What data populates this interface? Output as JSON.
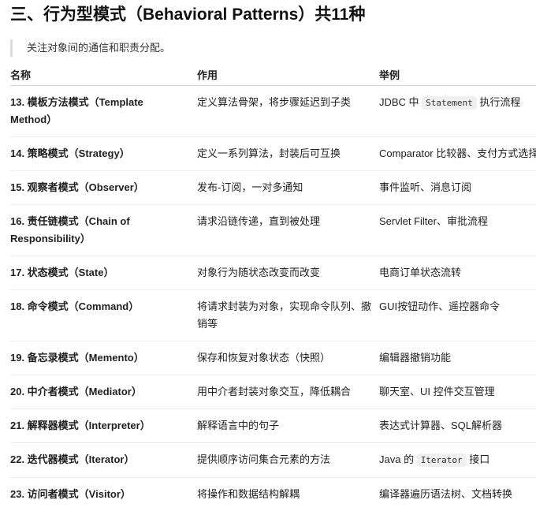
{
  "heading": "三、行为型模式（Behavioral Patterns）共11种",
  "note": "关注对象间的通信和职责分配。",
  "table": {
    "headers": [
      "名称",
      "作用",
      "举例"
    ],
    "rows": [
      {
        "name": "13. 模板方法模式（Template Method）",
        "purpose": "定义算法骨架，将步骤延迟到子类",
        "ex_before": "JDBC 中 ",
        "ex_code": "Statement",
        "ex_after": " 执行流程"
      },
      {
        "name": "14. 策略模式（Strategy）",
        "purpose": "定义一系列算法，封装后可互换",
        "ex_before": "Comparator 比较器、支付方式选择",
        "ex_code": "",
        "ex_after": ""
      },
      {
        "name": "15. 观察者模式（Observer）",
        "purpose": "发布-订阅，一对多通知",
        "ex_before": "事件监听、消息订阅",
        "ex_code": "",
        "ex_after": ""
      },
      {
        "name": "16. 责任链模式（Chain of Responsibility）",
        "purpose": "请求沿链传递，直到被处理",
        "ex_before": "Servlet Filter、审批流程",
        "ex_code": "",
        "ex_after": ""
      },
      {
        "name": "17. 状态模式（State）",
        "purpose": "对象行为随状态改变而改变",
        "ex_before": "电商订单状态流转",
        "ex_code": "",
        "ex_after": ""
      },
      {
        "name": "18. 命令模式（Command）",
        "purpose": "将请求封装为对象，实现命令队列、撤销等",
        "ex_before": "GUI按钮动作、遥控器命令",
        "ex_code": "",
        "ex_after": ""
      },
      {
        "name": "19. 备忘录模式（Memento）",
        "purpose": "保存和恢复对象状态（快照）",
        "ex_before": "编辑器撤销功能",
        "ex_code": "",
        "ex_after": ""
      },
      {
        "name": "20. 中介者模式（Mediator）",
        "purpose": "用中介者封装对象交互，降低耦合",
        "ex_before": "聊天室、UI 控件交互管理",
        "ex_code": "",
        "ex_after": ""
      },
      {
        "name": "21. 解释器模式（Interpreter）",
        "purpose": "解释语言中的句子",
        "ex_before": "表达式计算器、SQL解析器",
        "ex_code": "",
        "ex_after": ""
      },
      {
        "name": "22. 迭代器模式（Iterator）",
        "purpose": "提供顺序访问集合元素的方法",
        "ex_before": "Java 的 ",
        "ex_code": "Iterator",
        "ex_after": " 接口"
      },
      {
        "name": "23. 访问者模式（Visitor）",
        "purpose": "将操作和数据结构解耦",
        "ex_before": "编译器遍历语法树、文档转换",
        "ex_code": "",
        "ex_after": ""
      }
    ]
  }
}
